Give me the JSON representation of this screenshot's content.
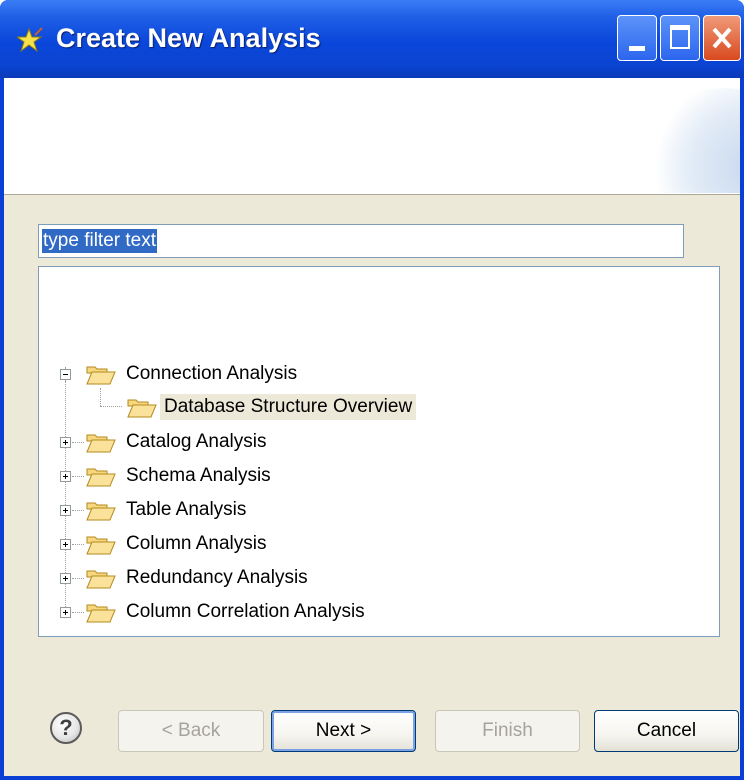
{
  "window": {
    "title": "Create New Analysis",
    "colors": {
      "titlebar": "#0a46da",
      "close_button": "#d94a1f",
      "dialog_bg": "#ece9d8",
      "selection": "#316ac5"
    }
  },
  "filter": {
    "value": "type filter text"
  },
  "tree": {
    "items": [
      {
        "label": "Connection Analysis",
        "expanded": true,
        "children": [
          {
            "label": "Database Structure Overview",
            "selected": true
          }
        ]
      },
      {
        "label": "Catalog Analysis",
        "expanded": false
      },
      {
        "label": "Schema Analysis",
        "expanded": false
      },
      {
        "label": "Table Analysis",
        "expanded": false
      },
      {
        "label": "Column Analysis",
        "expanded": false
      },
      {
        "label": "Redundancy Analysis",
        "expanded": false
      },
      {
        "label": "Column Correlation Analysis",
        "expanded": false
      }
    ]
  },
  "buttons": {
    "help": "?",
    "back": "< Back",
    "next": "Next >",
    "finish": "Finish",
    "cancel": "Cancel"
  },
  "icons": {
    "title": "wizard-star-icon",
    "folder": "folder-open-icon"
  }
}
